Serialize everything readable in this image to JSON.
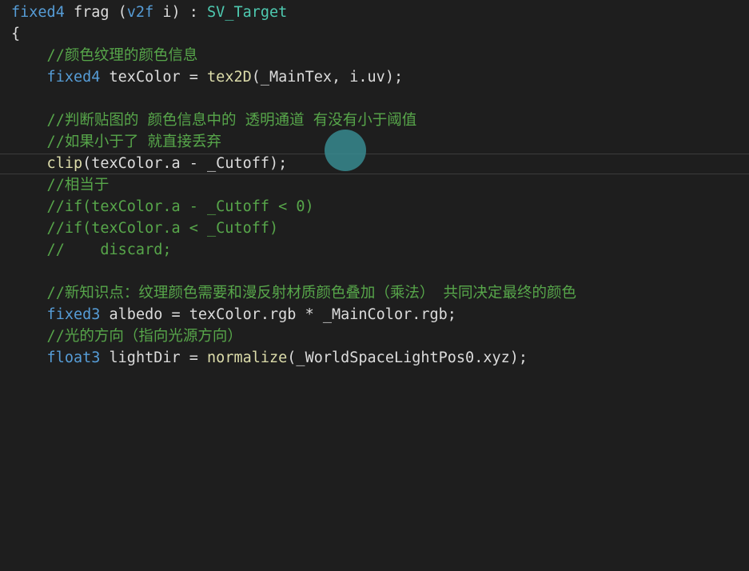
{
  "code": {
    "l1": {
      "a": "fixed4",
      "b": " frag (",
      "c": "v2f",
      "d": " i) : ",
      "e": "SV_Target"
    },
    "l2": "{",
    "l3": "    //颜色纹理的颜色信息",
    "l4": {
      "a": "    fixed4",
      "b": " texColor = ",
      "c": "tex2D",
      "d": "(_MainTex, i.uv);"
    },
    "l6": "    //判断贴图的 颜色信息中的 透明通道 有没有小于阈值",
    "l7": "    //如果小于了 就直接丢弃",
    "l8": {
      "a": "    clip",
      "b": "(texColor.a - _Cutoff);"
    },
    "l9": "    //相当于",
    "l10": "    //if(texColor.a - _Cutoff < 0)",
    "l11": "    //if(texColor.a < _Cutoff)",
    "l12": "    //    discard;",
    "l14": "    //新知识点：纹理颜色需要和漫反射材质颜色叠加（乘法） 共同决定最终的颜色",
    "l15": {
      "a": "    fixed3",
      "b": " albedo = texColor.rgb * _MainColor.rgb;"
    },
    "l16": "    //光的方向（指向光源方向）",
    "l17": {
      "a": "    float3",
      "b": " lightDir = ",
      "c": "normalize",
      "d": "(_WorldSpaceLightPos0.xyz);"
    }
  },
  "colors": {
    "background": "#1e1e1e",
    "keyword": "#569cd6",
    "function": "#dcdcaa",
    "comment": "#57a64a",
    "text": "#dcdcdc"
  }
}
